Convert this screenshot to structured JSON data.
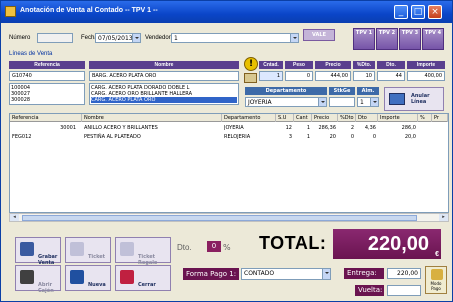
{
  "window": {
    "title": "Anotación de Venta al Contado -- TPV 1 --"
  },
  "header": {
    "numero_label": "Número",
    "numero_value": "",
    "fecha_label": "Fecha",
    "fecha_value": "07/05/2013",
    "vendedor_label": "Vendedor",
    "vendedor_value": "1",
    "vale_label": "VALE",
    "tpv_buttons": [
      "TPV 1",
      "TPV 2",
      "TPV 3",
      "TPV 4"
    ]
  },
  "lineas": {
    "section_label": "Líneas de Venta",
    "headers": {
      "referencia": "Referencia",
      "nombre": "Nombre",
      "cantidad": "Cntad.",
      "peso": "Peso",
      "precio": "Precio",
      "dto": "%Dto.",
      "dto2": "Dto.",
      "importe": "Importe"
    },
    "current": {
      "referencia": "G10740",
      "nombre": "BARG. ACERO PLATA ORO",
      "cantidad": "1",
      "peso": "0",
      "precio": "444,00",
      "dto": "10",
      "dto2": "44",
      "importe": "400,00"
    },
    "ref_list": [
      "100004",
      "300027",
      "300028"
    ],
    "name_list": [
      "CARG. ACERO PLATA DORADO DOBLE L",
      "CARG. ACERO ORO BRILLANTE HALLERA",
      "CARG. ACERO PLATA ORO"
    ],
    "headers2": {
      "departamento": "Departamento",
      "stkg": "StkGe",
      "alm": "Alm."
    },
    "departamento_value": "JOYERIA",
    "alm_value": "1",
    "anular_label": "Anular Línea"
  },
  "grid": {
    "columns": [
      "Referencia",
      "Nombre",
      "Departamento",
      "S.U",
      "Cant",
      "Precio",
      "%Dto",
      "Dto",
      "Importe",
      "%",
      "Pr"
    ],
    "rows": [
      [
        "30001",
        "ANILLO ACERO Y BRILLANTES",
        "JOYERIA",
        "12",
        "1",
        "286,36",
        "2",
        "4,36",
        "286,0",
        "",
        ""
      ],
      [
        "FEG012",
        "PESTIÑA AL PLATEADO",
        "RELOJERIA",
        "3",
        "1",
        "20",
        "0",
        "0",
        "20,0",
        "",
        ""
      ]
    ]
  },
  "buttons": {
    "grabar": "Grabar\nVenta",
    "ticket": "Ticket",
    "ticket_regalo": "Ticket\nRegalo",
    "abrir_cajon": "Abrir\nCajón",
    "nueva": "Nueva",
    "cerrar": "Cerrar"
  },
  "totals": {
    "dto_label": "Dto.",
    "dto_value": "0",
    "dto_pct": "%",
    "total_label": "TOTAL:",
    "total_value": "220,00",
    "currency": "€",
    "forma_pago_label": "Forma Pago 1:",
    "forma_pago_value": "CONTADO",
    "entrega_label": "Entrega:",
    "entrega_value": "220,00",
    "vuelta_label": "Vuelta:",
    "vuelta_value": "",
    "modo_label": "Modo Pago"
  }
}
